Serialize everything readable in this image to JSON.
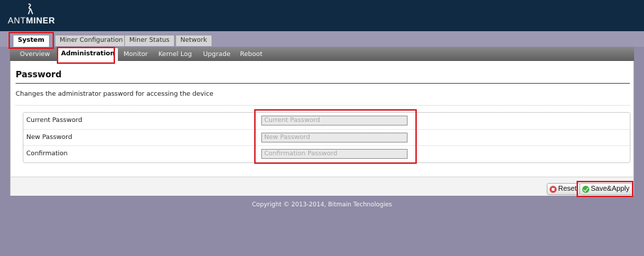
{
  "app": {
    "logo_light": "ANT",
    "logo_bold": "MINER"
  },
  "top_tabs": [
    {
      "label": "System",
      "active": true
    },
    {
      "label": "Miner Configuration",
      "active": false
    },
    {
      "label": "Miner Status",
      "active": false
    },
    {
      "label": "Network",
      "active": false
    }
  ],
  "sub_tabs": [
    {
      "label": "Overview",
      "active": false
    },
    {
      "label": "Administration",
      "active": true
    },
    {
      "label": "Monitor",
      "active": false
    },
    {
      "label": "Kernel Log",
      "active": false
    },
    {
      "label": "Upgrade",
      "active": false
    },
    {
      "label": "Reboot",
      "active": false
    }
  ],
  "page": {
    "title": "Password",
    "description": "Changes the administrator password for accessing the device"
  },
  "form": {
    "rows": [
      {
        "label": "Current Password",
        "placeholder": "Current Password",
        "value": ""
      },
      {
        "label": "New Password",
        "placeholder": "New Password",
        "value": ""
      },
      {
        "label": "Confirmation",
        "placeholder": "Confirmation Password",
        "value": ""
      }
    ]
  },
  "actions": {
    "reset_label": "Reset",
    "save_label": "Save&Apply"
  },
  "footer": {
    "copyright": "Copyright © 2013-2014, Bitmain Technologies"
  },
  "colors": {
    "header": "#0f2a42",
    "background": "#8f8aa6",
    "highlight": "#d61f26"
  },
  "icons": [
    "antminer-logo-icon",
    "reset-icon",
    "save-apply-icon"
  ]
}
